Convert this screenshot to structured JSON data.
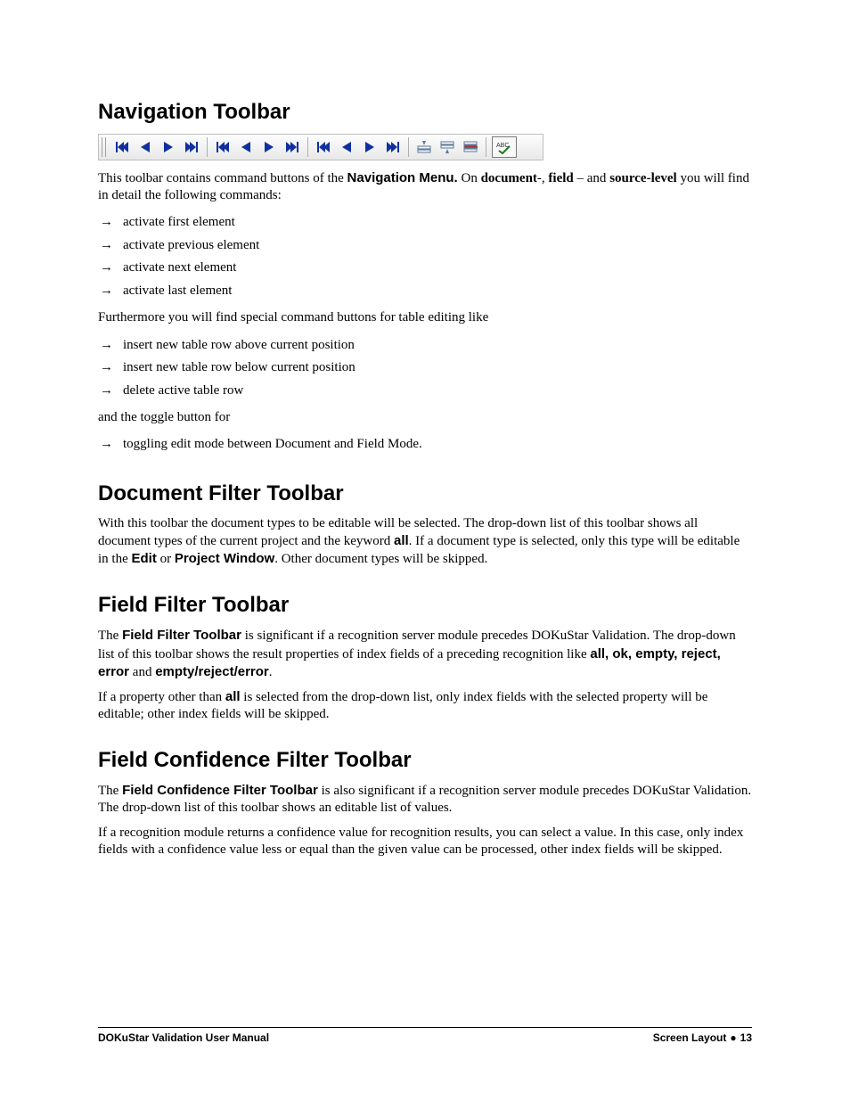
{
  "sections": {
    "nav": {
      "heading": "Navigation Toolbar",
      "intro_a": "This toolbar contains command buttons of the ",
      "intro_b": "Navigation Menu.",
      "intro_c": " On ",
      "intro_d": "document",
      "intro_e": "-, ",
      "intro_f": "field",
      "intro_g": " – and ",
      "intro_h": "source-level",
      "intro_i": " you will find in detail the following commands:",
      "list1": [
        "activate first element",
        "activate previous element",
        "activate next element",
        "activate last element"
      ],
      "mid": "Furthermore you will find special command buttons for table editing like",
      "list2": [
        "insert new table row above current position",
        "insert new table row below current position",
        "delete active table row"
      ],
      "toggle_intro": "and the toggle button for",
      "list3": [
        "toggling edit mode between Document and Field Mode."
      ]
    },
    "docfilter": {
      "heading": "Document Filter Toolbar",
      "p1_a": "With this toolbar the document types to be editable will be selected. The drop-down list of this toolbar shows all document types of the current project and the keyword ",
      "p1_b": "all",
      "p1_c": ". If a document type is selected, only this type will be editable in the ",
      "p1_d": "Edit",
      "p1_e": " or ",
      "p1_f": "Project Window",
      "p1_g": ". Other document types will be skipped."
    },
    "fieldfilter": {
      "heading": "Field Filter Toolbar",
      "p1_a": "The ",
      "p1_b": "Field Filter Toolbar",
      "p1_c": " is significant if a recognition server module precedes DOKuStar Validation. The drop-down list of this toolbar shows the result properties of index fields of a preceding recognition like ",
      "p1_d": "all, ok, empty, reject, error",
      "p1_e": " and ",
      "p1_f": "empty/reject/error",
      "p1_g": ".",
      "p2_a": "If a property other than ",
      "p2_b": "all",
      "p2_c": " is selected from the drop-down list, only index fields with the selected property will be editable; other index fields will be skipped."
    },
    "confidence": {
      "heading": "Field Confidence Filter Toolbar",
      "p1_a": "The ",
      "p1_b": "Field Confidence Filter Toolbar",
      "p1_c": " is also significant if a recognition server module precedes DOKuStar Validation. The drop-down list of this toolbar shows an editable list of values.",
      "p2": "If a recognition module returns a confidence value for recognition results, you can select a value. In this case, only index fields with a confidence value less or equal than the given value can be processed, other index fields will be skipped."
    }
  },
  "toolbar_buttons": {
    "groups": 3,
    "per_group": [
      "first",
      "prev",
      "next",
      "last"
    ],
    "table_ops": [
      "insert-row-above",
      "insert-row-below",
      "delete-row"
    ],
    "toggle": "abc-check"
  },
  "footer": {
    "left": "DOKuStar Validation User Manual",
    "section": "Screen Layout",
    "page": "13"
  }
}
